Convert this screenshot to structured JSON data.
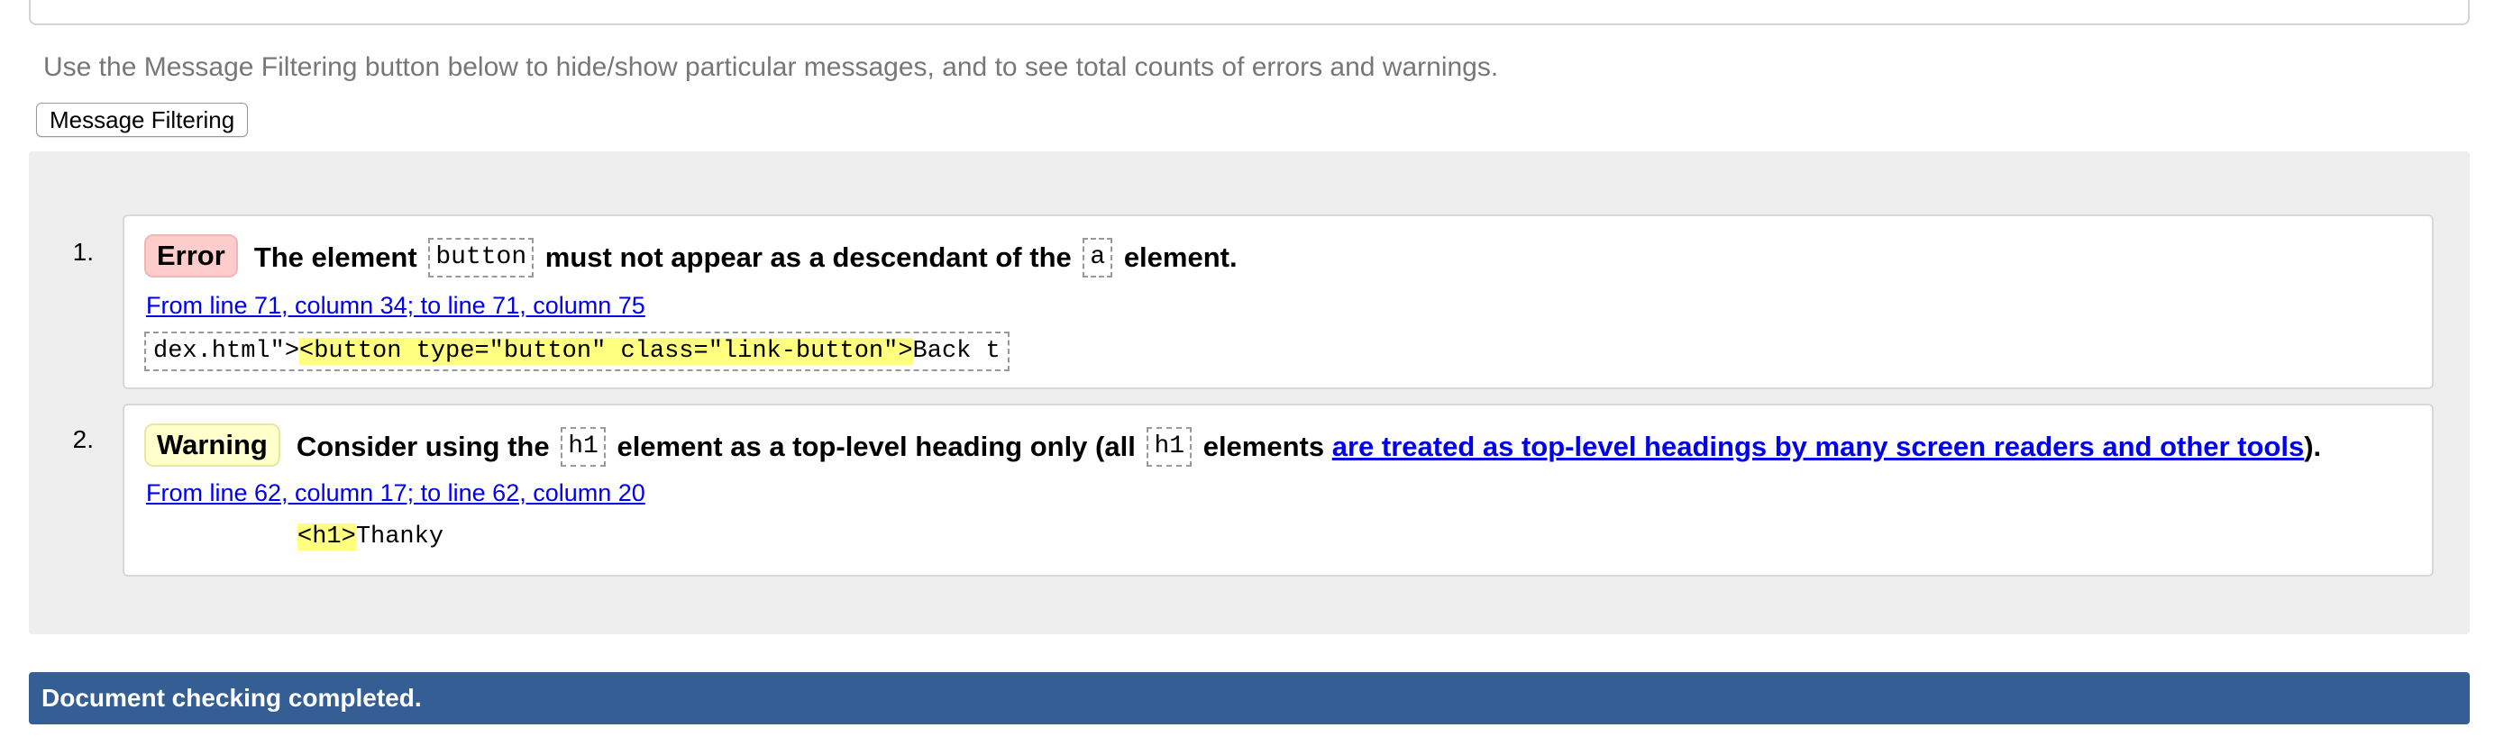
{
  "intro_text": "Use the Message Filtering button below to hide/show particular messages, and to see total counts of errors and warnings.",
  "filter_button_label": "Message Filtering",
  "messages": [
    {
      "number": "1.",
      "type_label": "Error",
      "text_1": "The element",
      "code_1": "button",
      "text_2": "must not appear as a descendant of the",
      "code_2": "a",
      "text_3": "element.",
      "location": "From line 71, column 34; to line 71, column 75",
      "extract_before": "dex.html\">",
      "extract_highlight": "<button type=\"button\" class=\"link-button\">",
      "extract_after": "Back t"
    },
    {
      "number": "2.",
      "type_label": "Warning",
      "text_1": "Consider using the",
      "code_1": "h1",
      "text_2": "element as a top-level heading only (all",
      "code_2": "h1",
      "text_3": "elements",
      "link_text": "are treated as top-level headings by many screen readers and other tools",
      "text_4": ").",
      "location": "From line 62, column 17; to line 62, column 20",
      "extract_highlight": "<h1>",
      "extract_after": "Thanky"
    }
  ],
  "status_text": "Document checking completed.",
  "colors": {
    "status_bar": "#355e95",
    "error_badge": "#ffcccc",
    "warning_badge": "#ffffcc",
    "highlight": "#ffff80",
    "link": "#0000ee"
  }
}
